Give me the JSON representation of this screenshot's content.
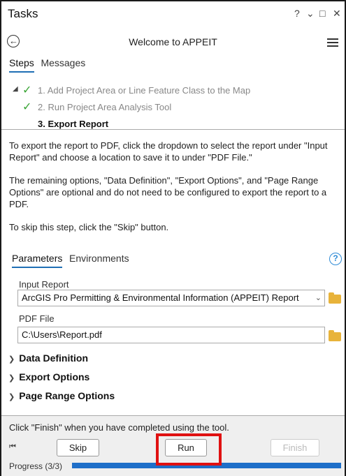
{
  "window": {
    "title": "Tasks",
    "controls": {
      "help": "?",
      "dropdown": "⌄",
      "maximize": "□",
      "close": "✕"
    }
  },
  "nav": {
    "heading": "Welcome to APPEIT"
  },
  "tabs": [
    {
      "label": "Steps",
      "active": true
    },
    {
      "label": "Messages",
      "active": false
    }
  ],
  "steps": [
    {
      "label": "1.  Add Project Area or Line Feature Class to the Map",
      "done": true
    },
    {
      "label": "2.  Run Project Area Analysis Tool",
      "done": true
    },
    {
      "label": "3.  Export Report",
      "done": false,
      "current": true
    }
  ],
  "description": [
    "To export the report to PDF, click the dropdown to select the report under \"Input Report\" and choose a location to save it to under \"PDF File.\"",
    "The remaining options, \"Data Definition\", \"Export Options\", and \"Page Range Options\" are optional and do not need to be configured to export the report to a PDF.",
    "To skip this step, click the \"Skip\" button."
  ],
  "param_tabs": [
    {
      "label": "Parameters",
      "active": true
    },
    {
      "label": "Environments",
      "active": false
    }
  ],
  "params": {
    "input_report": {
      "label": "Input Report",
      "value": "ArcGIS Pro Permitting & Environmental Information (APPEIT) Report"
    },
    "pdf_file": {
      "label": "PDF File",
      "value": "C:\\Users\\Report.pdf"
    }
  },
  "groups": [
    "Data Definition",
    "Export Options",
    "Page Range Options"
  ],
  "footer": {
    "message": "Click \"Finish\" when you have completed using the tool.",
    "skip_label": "Skip",
    "run_label": "Run",
    "finish_label": "Finish",
    "progress_label": "Progress (3/3)",
    "progress": 1.0
  },
  "colors": {
    "accent": "#1f6fc9",
    "check": "#3aa535",
    "highlight": "#e01111",
    "folder": "#e8b33a"
  }
}
